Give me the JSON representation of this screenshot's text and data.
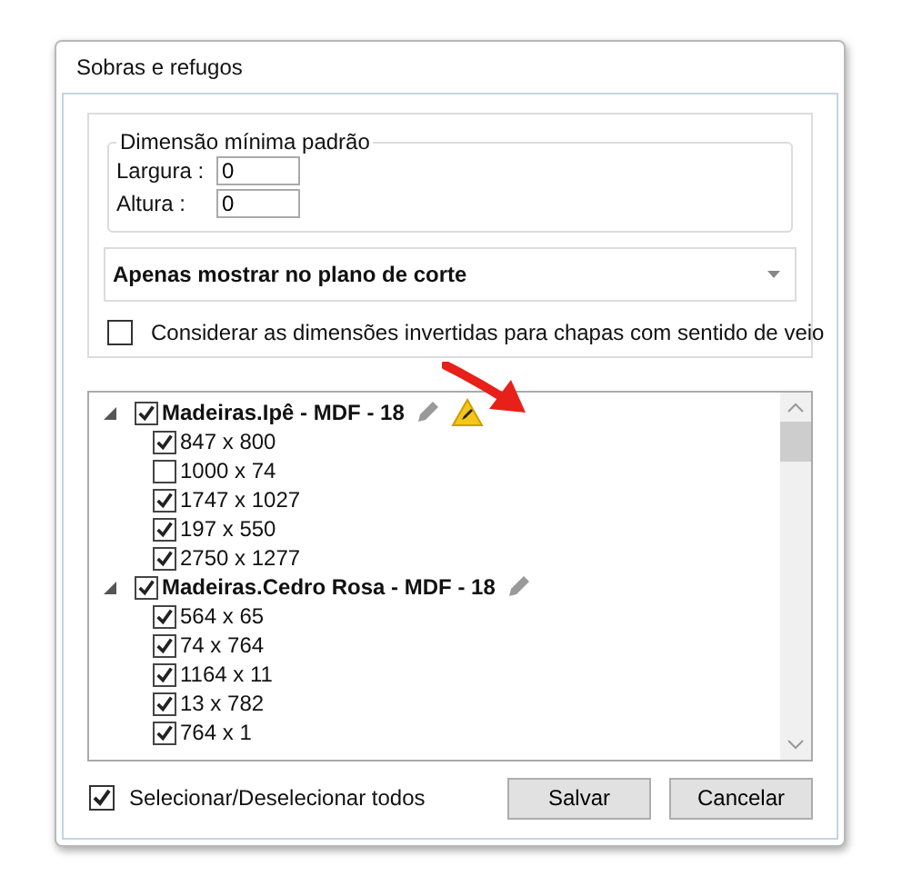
{
  "window": {
    "title": "Sobras e refugos"
  },
  "min_dimension": {
    "legend": "Dimensão mínima padrão",
    "fields": [
      {
        "label": "Largura :",
        "value": "0"
      },
      {
        "label": "Altura :",
        "value": "0"
      }
    ]
  },
  "display_mode": {
    "value": "Apenas mostrar no plano de corte"
  },
  "invert_option": {
    "label": "Considerar as dimensões invertidas para chapas com sentido de veio",
    "checked": false
  },
  "tree": {
    "groups": [
      {
        "label": "Madeiras.Ipê - MDF - 18",
        "checked": true,
        "expanded": true,
        "warning": true,
        "children": [
          {
            "label": "847 x 800",
            "checked": true
          },
          {
            "label": "1000 x 74",
            "checked": false
          },
          {
            "label": "1747 x 1027",
            "checked": true
          },
          {
            "label": "197 x 550",
            "checked": true
          },
          {
            "label": "2750 x 1277",
            "checked": true
          }
        ]
      },
      {
        "label": "Madeiras.Cedro Rosa - MDF - 18",
        "checked": true,
        "expanded": true,
        "warning": false,
        "children": [
          {
            "label": "564 x 65",
            "checked": true
          },
          {
            "label": "74 x 764",
            "checked": true
          },
          {
            "label": "1164 x 11",
            "checked": true
          },
          {
            "label": "13 x 782",
            "checked": true
          },
          {
            "label": "764 x 1",
            "checked": true
          }
        ]
      }
    ]
  },
  "select_all": {
    "label": "Selecionar/Deselecionar todos",
    "checked": true
  },
  "buttons": [
    {
      "label": "Salvar"
    },
    {
      "label": "Cancelar"
    }
  ]
}
